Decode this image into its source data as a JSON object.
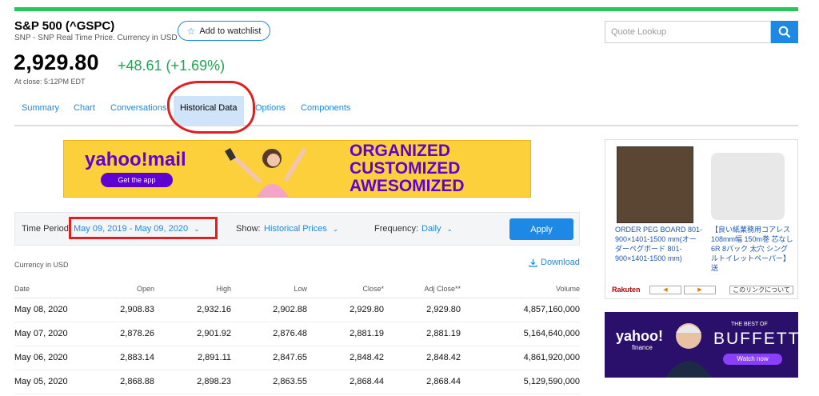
{
  "quote": {
    "title": "S&P 500 (^GSPC)",
    "subtitle": "SNP - SNP Real Time Price. Currency in USD",
    "watchlist_label": "Add to watchlist",
    "price": "2,929.80",
    "change": "+48.61 (+1.69%)",
    "close_time": "At close: 5:12PM EDT"
  },
  "search": {
    "placeholder": "Quote Lookup"
  },
  "tabs": [
    {
      "label": "Summary"
    },
    {
      "label": "Chart"
    },
    {
      "label": "Conversations"
    },
    {
      "label": "Historical Data"
    },
    {
      "label": "Options"
    },
    {
      "label": "Components"
    }
  ],
  "ad_banner": {
    "logo": "yahoo!mail",
    "cta": "Get the app",
    "line1": "ORGANIZED",
    "line2": "CUSTOMIZED",
    "line3": "AWESOMIZED"
  },
  "filters": {
    "time_period_label": "Time Period:",
    "time_period_value": "May 09, 2019 - May 09, 2020",
    "show_label": "Show:",
    "show_value": "Historical Prices",
    "frequency_label": "Frequency:",
    "frequency_value": "Daily",
    "apply_label": "Apply"
  },
  "currency_note": "Currency in USD",
  "download_label": "Download",
  "table": {
    "headers": [
      "Date",
      "Open",
      "High",
      "Low",
      "Close*",
      "Adj Close**",
      "Volume"
    ],
    "rows": [
      [
        "May 08, 2020",
        "2,908.83",
        "2,932.16",
        "2,902.88",
        "2,929.80",
        "2,929.80",
        "4,857,160,000"
      ],
      [
        "May 07, 2020",
        "2,878.26",
        "2,901.92",
        "2,876.48",
        "2,881.19",
        "2,881.19",
        "5,164,640,000"
      ],
      [
        "May 06, 2020",
        "2,883.14",
        "2,891.11",
        "2,847.65",
        "2,848.42",
        "2,848.42",
        "4,861,920,000"
      ],
      [
        "May 05, 2020",
        "2,868.88",
        "2,898.23",
        "2,863.55",
        "2,868.44",
        "2,868.44",
        "5,129,590,000"
      ]
    ]
  },
  "side_ad1": {
    "item1": "ORDER PEG BOARD 801-900×1401-1500 mm(オーダーペグボード 801-900×1401-1500 mm)",
    "item2": "【良い紙業務用コアレス108mm幅 150m巻 芯なし 6R 8パック 太穴 シングルトイレットペーパー】送",
    "brand": "Rakuten",
    "link": "このリンクについて"
  },
  "side_ad2": {
    "logo": "yahoo!",
    "logo_sub": "finance",
    "tag_small": "THE BEST OF",
    "tag_big": "BUFFETT",
    "cta": "Watch now"
  },
  "colors": {
    "brand_green": "#26c659",
    "link_blue": "#1e88e5",
    "gain_green": "#21a453",
    "annotation_red": "#e02020"
  }
}
